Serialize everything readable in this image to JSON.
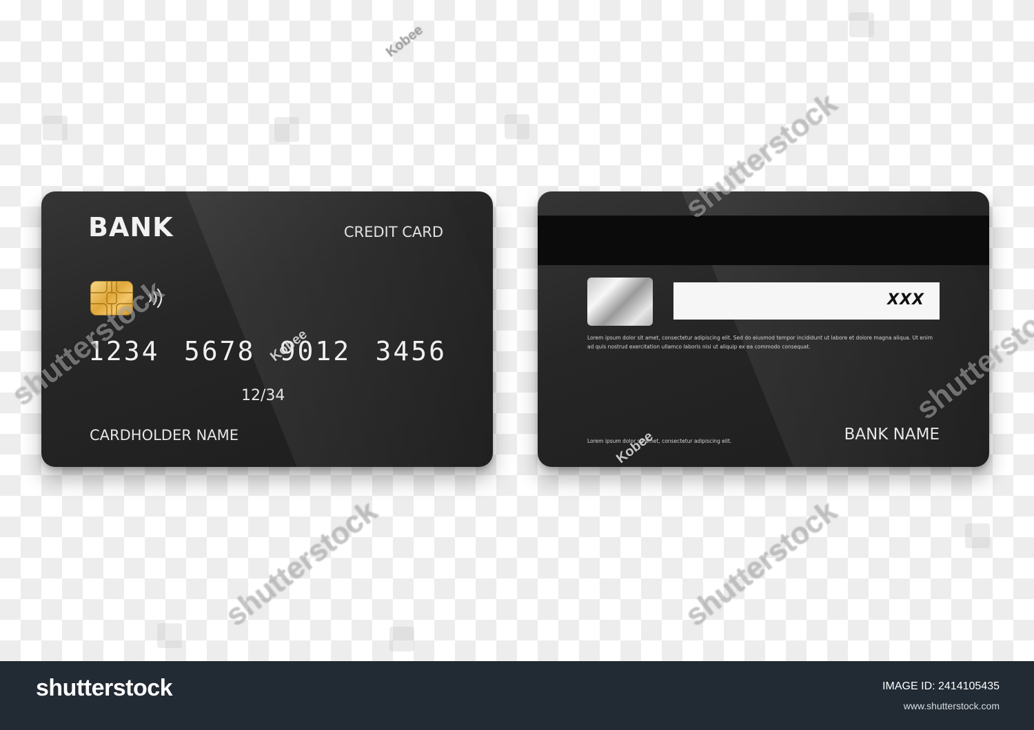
{
  "front_card": {
    "bank_logo": "BANK",
    "card_type": "CREDIT CARD",
    "number_groups": [
      "1234",
      "5678",
      "9012",
      "3456"
    ],
    "expiry": "12/34",
    "cardholder": "CARDHOLDER NAME"
  },
  "back_card": {
    "cvv": "XXX",
    "terms_text": "Lorem ipsum dolor sit amet, consectetur adipiscing elit. Sed do eiusmod tempor incididunt ut labore et dolore magna aliqua. Ut enim ad quis nostrud exercitation ullamco laboris nisi ut aliquip ex ea commodo consequat.",
    "footer_text": "Lorem ipsum dolor sit amet, consectetur adipiscing elit.",
    "bank_name": "BANK NAME"
  },
  "watermarks": {
    "brand": "shutterstock",
    "contributor": "Kobee"
  },
  "stock_bar": {
    "logo": "shutterstock",
    "image_id_label": "IMAGE ID: 2414105435",
    "url": "www.shutterstock.com"
  }
}
